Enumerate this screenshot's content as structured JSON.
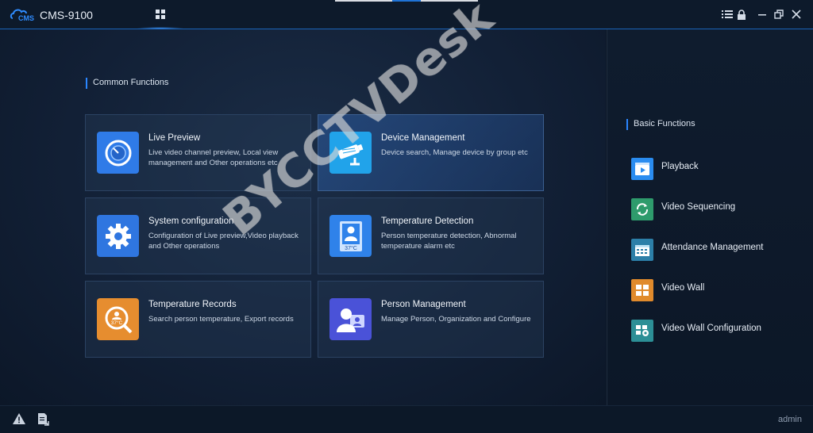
{
  "app": {
    "title": "CMS-9100",
    "logo_text": "CMS"
  },
  "common": {
    "title": "Common Functions",
    "cards": [
      {
        "title": "Live Preview",
        "desc": "Live video channel preview, Local view management and Other operations etc",
        "icon": "clock-icon",
        "color": "#2f7be8"
      },
      {
        "title": "Device Management",
        "desc": "Device search, Manage device by group etc",
        "icon": "camera-icon",
        "color": "#21a3ea"
      },
      {
        "title": "System configuration",
        "desc": "Configuration of Live preview,Video playback and Other operations",
        "icon": "gear-icon",
        "color": "#2f76e0"
      },
      {
        "title": "Temperature Detection",
        "desc": "Person temperature detection, Abnormal temperature alarm etc",
        "icon": "temperature-screen-icon",
        "color": "#2f82ea"
      },
      {
        "title": "Temperature Records",
        "desc": "Search person temperature, Export records",
        "icon": "temperature-search-icon",
        "color": "#e68d2f"
      },
      {
        "title": "Person Management",
        "desc": "Manage Person, Organization and Configure",
        "icon": "person-card-icon",
        "color": "#4a52d8"
      }
    ],
    "temp_label": "37°C"
  },
  "basic": {
    "title": "Basic Functions",
    "items": [
      {
        "label": "Playback",
        "icon": "playback-icon",
        "color": "#2a8cf0"
      },
      {
        "label": "Video Sequencing",
        "icon": "sequence-icon",
        "color": "#2e9b6c"
      },
      {
        "label": "Attendance Management",
        "icon": "attendance-icon",
        "color": "#2c7fa8"
      },
      {
        "label": "Video Wall",
        "icon": "video-wall-icon",
        "color": "#e08a2c"
      },
      {
        "label": "Video Wall Configuration",
        "icon": "video-wall-config-icon",
        "color": "#2c8f96"
      }
    ]
  },
  "status": {
    "user": "admin"
  },
  "watermark": "BYCCTVDesk"
}
